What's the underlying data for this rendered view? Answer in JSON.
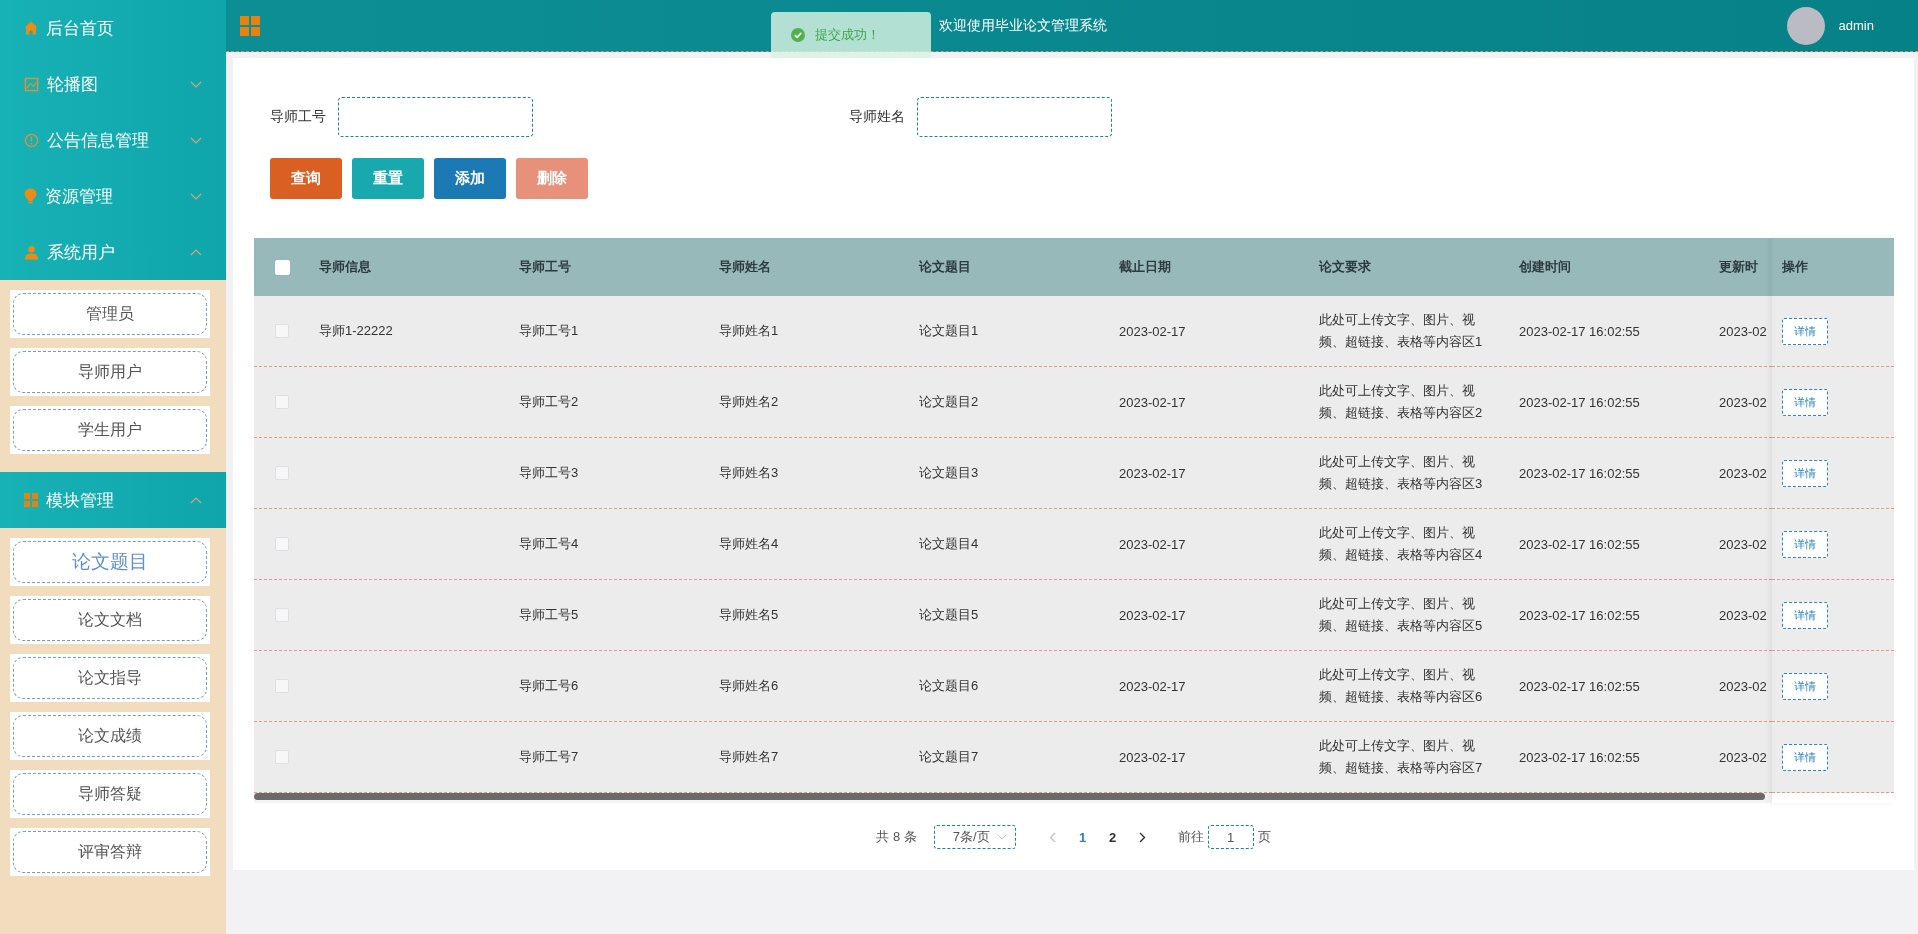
{
  "header": {
    "title": "欢迎使用毕业论文管理系统",
    "user": "admin"
  },
  "toast": {
    "message": "提交成功！"
  },
  "sidebar": {
    "home": {
      "label": "后台首页"
    },
    "groups": [
      {
        "label": "轮播图",
        "expanded": false
      },
      {
        "label": "公告信息管理",
        "expanded": false
      },
      {
        "label": "资源管理",
        "expanded": false
      },
      {
        "label": "系统用户",
        "expanded": true,
        "children": [
          {
            "label": "管理员",
            "selected": false
          },
          {
            "label": "导师用户",
            "selected": false
          },
          {
            "label": "学生用户",
            "selected": false
          }
        ]
      },
      {
        "label": "模块管理",
        "expanded": true,
        "children": [
          {
            "label": "论文题目",
            "selected": true
          },
          {
            "label": "论文文档",
            "selected": false
          },
          {
            "label": "论文指导",
            "selected": false
          },
          {
            "label": "论文成绩",
            "selected": false
          },
          {
            "label": "导师答疑",
            "selected": false
          },
          {
            "label": "评审答辩",
            "selected": false
          }
        ]
      }
    ]
  },
  "search": {
    "fields": [
      {
        "label": "导师工号"
      },
      {
        "label": "导师姓名"
      }
    ],
    "buttons": [
      {
        "label": "查询",
        "kind": "search"
      },
      {
        "label": "重置",
        "kind": "reset"
      },
      {
        "label": "添加",
        "kind": "add"
      },
      {
        "label": "删除",
        "kind": "delete"
      }
    ]
  },
  "table": {
    "select_all": {
      "checked": false
    },
    "columns": [
      "导师信息",
      "导师工号",
      "导师姓名",
      "论文题目",
      "截止日期",
      "论文要求",
      "创建时间",
      "更新时"
    ],
    "action_column": "操作",
    "rows": [
      {
        "checked": false,
        "tutor_info": "导师1-22222",
        "tutor_id": "导师工号1",
        "tutor_name": "导师姓名1",
        "topic": "论文题目1",
        "deadline": "2023-02-17",
        "requirement": "此处可上传文字、图片、视频、超链接、表格等内容区1",
        "created": "2023-02-17 16:02:55",
        "updated": "2023-02",
        "action": "详情"
      },
      {
        "checked": false,
        "tutor_id": "导师工号2",
        "tutor_name": "导师姓名2",
        "topic": "论文题目2",
        "deadline": "2023-02-17",
        "requirement": "此处可上传文字、图片、视频、超链接、表格等内容区2",
        "created": "2023-02-17 16:02:55",
        "updated": "2023-02",
        "action": "详情"
      },
      {
        "checked": false,
        "tutor_id": "导师工号3",
        "tutor_name": "导师姓名3",
        "topic": "论文题目3",
        "deadline": "2023-02-17",
        "requirement": "此处可上传文字、图片、视频、超链接、表格等内容区3",
        "created": "2023-02-17 16:02:55",
        "updated": "2023-02",
        "action": "详情"
      },
      {
        "checked": false,
        "tutor_id": "导师工号4",
        "tutor_name": "导师姓名4",
        "topic": "论文题目4",
        "deadline": "2023-02-17",
        "requirement": "此处可上传文字、图片、视频、超链接、表格等内容区4",
        "created": "2023-02-17 16:02:55",
        "updated": "2023-02",
        "action": "详情"
      },
      {
        "checked": false,
        "tutor_id": "导师工号5",
        "tutor_name": "导师姓名5",
        "topic": "论文题目5",
        "deadline": "2023-02-17",
        "requirement": "此处可上传文字、图片、视频、超链接、表格等内容区5",
        "created": "2023-02-17 16:02:55",
        "updated": "2023-02",
        "action": "详情"
      },
      {
        "checked": false,
        "tutor_id": "导师工号6",
        "tutor_name": "导师姓名6",
        "topic": "论文题目6",
        "deadline": "2023-02-17",
        "requirement": "此处可上传文字、图片、视频、超链接、表格等内容区6",
        "created": "2023-02-17 16:02:55",
        "updated": "2023-02",
        "action": "详情"
      },
      {
        "checked": false,
        "tutor_id": "导师工号7",
        "tutor_name": "导师姓名7",
        "topic": "论文题目7",
        "deadline": "2023-02-17",
        "requirement": "此处可上传文字、图片、视频、超链接、表格等内容区7",
        "created": "2023-02-17 16:02:55",
        "updated": "2023-02",
        "action": "详情"
      }
    ]
  },
  "pagination": {
    "total": "共 8 条",
    "page_size": "7条/页",
    "prev": {
      "disabled": true
    },
    "pages": [
      {
        "label": "1",
        "selected": true
      },
      {
        "label": "2",
        "selected": false
      }
    ],
    "next": {
      "disabled": false
    },
    "goto_label": "前往",
    "goto_value": "1",
    "goto_suffix": "页"
  }
}
